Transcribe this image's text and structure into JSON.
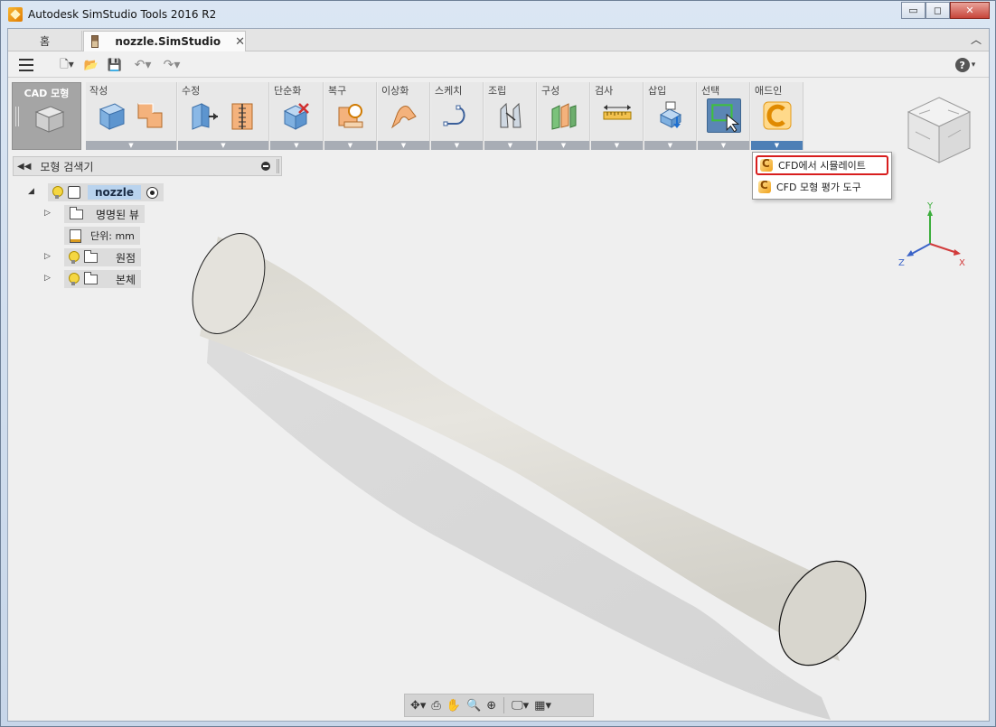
{
  "window": {
    "title": "Autodesk SimStudio Tools 2016 R2",
    "controls": {
      "minimize": "▭",
      "restore": "◻",
      "close": "✕"
    }
  },
  "tabs": {
    "home": "홈",
    "document": "nozzle.SimStudio",
    "close_glyph": "✕",
    "collapse_glyph": "︿"
  },
  "qat": {
    "new_glyph": "🗋▾",
    "open_glyph": "📂",
    "save_glyph": "💾",
    "undo_glyph": "↶▾",
    "redo_glyph": "↷▾",
    "help_glyph": "?",
    "help_caret": "▾"
  },
  "ribbon": {
    "cad_label": "CAD 모형",
    "groups": [
      {
        "label": "작성"
      },
      {
        "label": "수정"
      },
      {
        "label": "단순화"
      },
      {
        "label": "복구"
      },
      {
        "label": "이상화"
      },
      {
        "label": "스케치"
      },
      {
        "label": "조립"
      },
      {
        "label": "구성"
      },
      {
        "label": "검사"
      },
      {
        "label": "삽입"
      },
      {
        "label": "선택"
      },
      {
        "label": "애드인"
      }
    ],
    "arrow_glyph": "▼"
  },
  "dropdown": {
    "items": [
      {
        "label": "CFD에서 시뮬레이트"
      },
      {
        "label": "CFD 모형 평가 도구"
      }
    ]
  },
  "browser": {
    "title": "모형 검색기",
    "rewind_glyph": "◀◀",
    "root": "nozzle",
    "items": [
      {
        "label": "명명된 뷰"
      },
      {
        "label": "단위: mm"
      },
      {
        "label": "원점"
      },
      {
        "label": "본체"
      }
    ],
    "expanded_glyph": "◢",
    "collapsed_glyph": "▷"
  },
  "triad": {
    "x": "X",
    "y": "Y",
    "z": "Z"
  },
  "navbar": {
    "orbit_glyph": "✥▾",
    "look_glyph": "⎙",
    "pan_glyph": "✋",
    "zoom_glyph": "🔍",
    "fit_glyph": "⊕",
    "display_glyph": "🖵▾",
    "grid_glyph": "▦▾"
  },
  "colors": {
    "select_active": "#5b86b5",
    "highlight_border": "#d81e1e",
    "model_surface": "#e3e1da"
  }
}
